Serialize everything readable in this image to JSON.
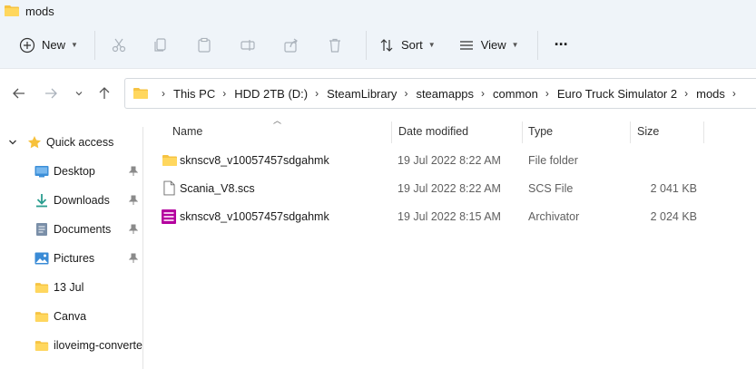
{
  "window": {
    "title": "mods",
    "icon": "folder-icon"
  },
  "toolbar": {
    "new_label": "New",
    "sort_label": "Sort",
    "view_label": "View",
    "more_label": "···"
  },
  "address": {
    "crumbs": [
      "This PC",
      "HDD 2TB (D:)",
      "SteamLibrary",
      "steamapps",
      "common",
      "Euro Truck Simulator 2",
      "mods"
    ]
  },
  "sidebar": {
    "quick_access": "Quick access",
    "items": [
      {
        "label": "Desktop",
        "icon": "desktop-icon",
        "pinned": true
      },
      {
        "label": "Downloads",
        "icon": "download-icon",
        "pinned": true
      },
      {
        "label": "Documents",
        "icon": "documents-icon",
        "pinned": true
      },
      {
        "label": "Pictures",
        "icon": "pictures-icon",
        "pinned": true
      },
      {
        "label": "13 Jul",
        "icon": "folder-icon",
        "pinned": false
      },
      {
        "label": "Canva",
        "icon": "folder-icon",
        "pinned": false
      },
      {
        "label": "iloveimg-converte",
        "icon": "folder-icon",
        "pinned": false
      }
    ]
  },
  "columns": {
    "name": "Name",
    "date": "Date modified",
    "type": "Type",
    "size": "Size"
  },
  "files": [
    {
      "name": "sknscv8_v10057457sdgahmk",
      "date": "19 Jul 2022 8:22 AM",
      "type": "File folder",
      "size": "",
      "icon": "folder-icon"
    },
    {
      "name": "Scania_V8.scs",
      "date": "19 Jul 2022 8:22 AM",
      "type": "SCS File",
      "size": "2 041 KB",
      "icon": "document-icon"
    },
    {
      "name": "sknscv8_v10057457sdgahmk",
      "date": "19 Jul 2022 8:15 AM",
      "type": "Archivator",
      "size": "2 024 KB",
      "icon": "archive-icon"
    }
  ],
  "colors": {
    "folder": "#f6c342",
    "accent": "#0067c0",
    "archive": "#b4009e",
    "chrome": "#eff4f9"
  }
}
